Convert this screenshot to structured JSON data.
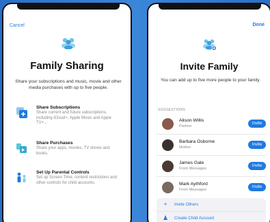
{
  "left": {
    "cancel_label": "Cancel",
    "title": "Family Sharing",
    "subtitle": "Share your subscriptions and music, movie and other media purchases with up to five people.",
    "features": [
      {
        "icon": "share-subscriptions-icon",
        "title": "Share Subscriptions",
        "description": "Share current and future subscriptions, including iCloud+, Apple Music and Apple TV+..."
      },
      {
        "icon": "share-purchases-icon",
        "title": "Share Purchases",
        "description": "Share your apps, movies, TV shows and books."
      },
      {
        "icon": "parental-controls-icon",
        "title": "Set Up Parental Controls",
        "description": "Set up Screen Time, content restrictions and other controls for child accounts."
      }
    ]
  },
  "right": {
    "done_label": "Done",
    "title": "Invite Family",
    "subtitle": "You can add up to five more people to your family.",
    "section_label": "SUGGESTIONS",
    "contacts": [
      {
        "name": "Alison Willis",
        "relation": "Partner",
        "invite_label": "Invite",
        "avatar_color": "#8a5a4a"
      },
      {
        "name": "Barbara Osborne",
        "relation": "Mother",
        "invite_label": "Invite",
        "avatar_color": "#3a3230"
      },
      {
        "name": "James Gale",
        "relation": "From Messages",
        "invite_label": "Invite",
        "avatar_color": "#4a3a30"
      },
      {
        "name": "Mark Aythford",
        "relation": "From Messages",
        "invite_label": "Invite",
        "avatar_color": "#7a6a60"
      }
    ],
    "actions": [
      {
        "icon": "plus-icon",
        "glyph": "+",
        "label": "Invite Others"
      },
      {
        "icon": "child-account-icon",
        "glyph": "♟",
        "label": "Create Child Account"
      }
    ]
  },
  "colors": {
    "accent": "#1f7ae0",
    "background": "#2f78cf"
  }
}
